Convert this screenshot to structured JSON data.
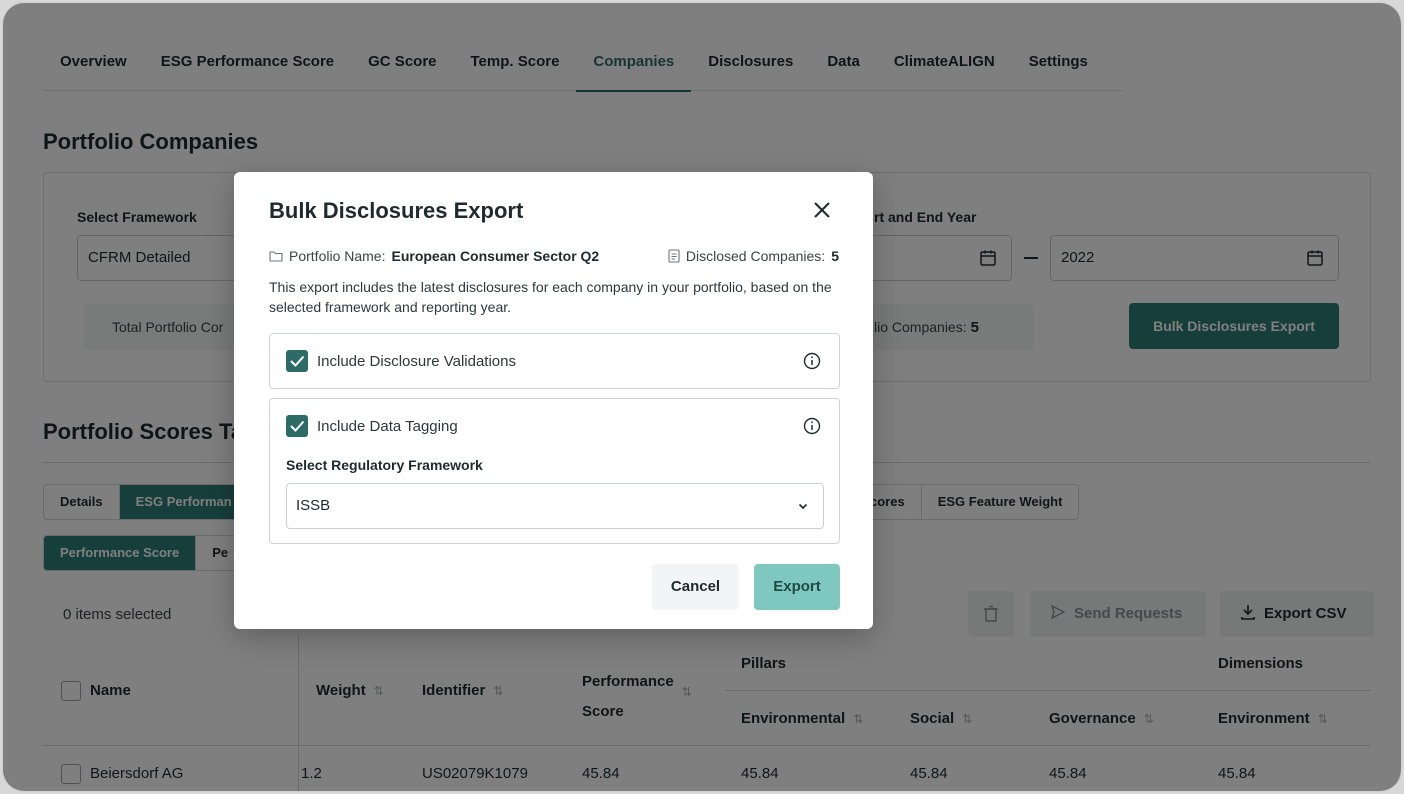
{
  "tabs": [
    "Overview",
    "ESG Performance Score",
    "GC Score",
    "Temp. Score",
    "Companies",
    "Disclosures",
    "Data",
    "ClimateALIGN",
    "Settings"
  ],
  "active_tab": "Companies",
  "portfolio": {
    "title": "Portfolio Companies",
    "framework_label": "Select Framework",
    "framework_value": "CFRM Detailed",
    "year_label": "rt and End Year",
    "end_year": "2022",
    "total_label": "Total Portfolio Cor",
    "disclosed_label": "lio Companies:",
    "disclosed_value": "5",
    "bulk_button": "Bulk Disclosures Export"
  },
  "scores": {
    "title": "Portfolio Scores Ta",
    "tabs": [
      "Details",
      "ESG Performan"
    ],
    "tabs_right": [
      "cores",
      "ESG Feature Weight"
    ],
    "subtabs": [
      "Performance Score",
      "Pe"
    ],
    "selected_count": "0 items selected",
    "send_requests": "Send Requests",
    "export_csv": "Export CSV"
  },
  "table": {
    "headers": {
      "name": "Name",
      "weight": "Weight",
      "identifier": "Identifier",
      "performance": "Performance",
      "score": "Score",
      "pillars": "Pillars",
      "dimensions": "Dimensions",
      "environmental": "Environmental",
      "social": "Social",
      "governance": "Governance",
      "environment": "Environment"
    },
    "rows": [
      {
        "name": "Beiersdorf AG",
        "weight": "1.2",
        "identifier": "US02079K1079",
        "performance": "45.84",
        "environmental": "45.84",
        "social": "45.84",
        "governance": "45.84",
        "environment": "45.84"
      }
    ]
  },
  "modal": {
    "title": "Bulk Disclosures Export",
    "portfolio_name_label": "Portfolio Name:",
    "portfolio_name_value": "European Consumer Sector Q2",
    "disclosed_label": "Disclosed Companies:",
    "disclosed_value": "5",
    "description": "This export includes the latest disclosures for each company in your portfolio, based on the selected framework and reporting year.",
    "option_validations": "Include Disclosure Validations",
    "option_tagging": "Include Data Tagging",
    "regulatory_label": "Select Regulatory Framework",
    "regulatory_value": "ISSB",
    "cancel": "Cancel",
    "export": "Export"
  },
  "colors": {
    "accent": "#2c7f77",
    "export_button": "#7ec8c0"
  }
}
